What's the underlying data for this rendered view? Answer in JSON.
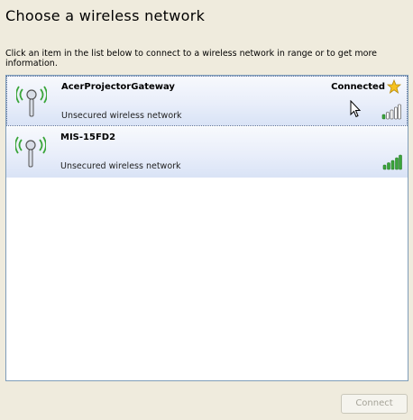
{
  "title": "Choose a wireless network",
  "instructions": "Click an item in the list below to connect to a wireless network in range or to get more information.",
  "networks": [
    {
      "name": "AcerProjectorGateway",
      "security": "Unsecured wireless network",
      "status": "Connected",
      "signal_bars_filled": 1,
      "selected": true
    },
    {
      "name": "MIS-15FD2",
      "security": "Unsecured wireless network",
      "status": "",
      "signal_bars_filled": 5,
      "selected": false
    }
  ],
  "connect_button": "Connect",
  "colors": {
    "background": "#efebdd",
    "list_border": "#7f9db9",
    "signal_green": "#3aa53a",
    "star": "#f7c21e"
  },
  "icons": [
    "wireless-antenna-icon",
    "favorite-star-icon",
    "signal-strength-icon",
    "mouse-cursor-icon"
  ]
}
